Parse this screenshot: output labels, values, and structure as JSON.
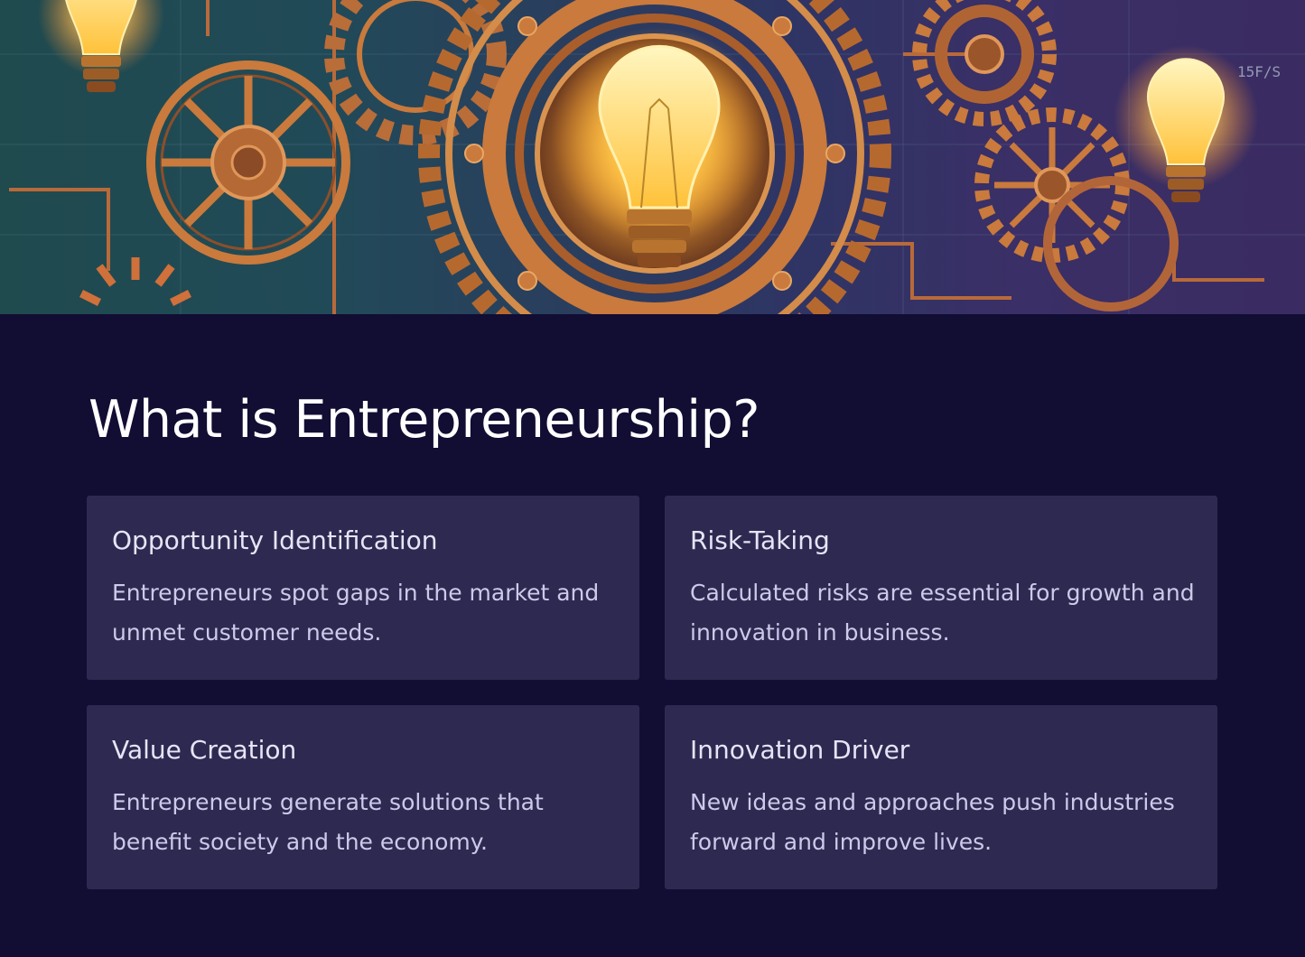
{
  "hero": {
    "image_description": "steampunk gears and glowing lightbulbs illustration",
    "annotation_text": "15F/S",
    "colors": {
      "bulb_glow": "#ffd35a",
      "copper": "#c97a3c",
      "teal_bg": "#1f4a4e",
      "purple_bg": "#3a2c62"
    }
  },
  "section": {
    "title": "What is Entrepreneurship?",
    "background": "#110d33",
    "card_background": "#2e2950"
  },
  "cards": [
    {
      "title": "Opportunity Identification",
      "text": "Entrepreneurs spot gaps in the market and unmet customer needs."
    },
    {
      "title": "Risk-Taking",
      "text": "Calculated risks are essential for growth and innovation in business."
    },
    {
      "title": "Value Creation",
      "text": "Entrepreneurs generate solutions that benefit society and the economy."
    },
    {
      "title": "Innovation Driver",
      "text": "New ideas and approaches push industries forward and improve lives."
    }
  ]
}
